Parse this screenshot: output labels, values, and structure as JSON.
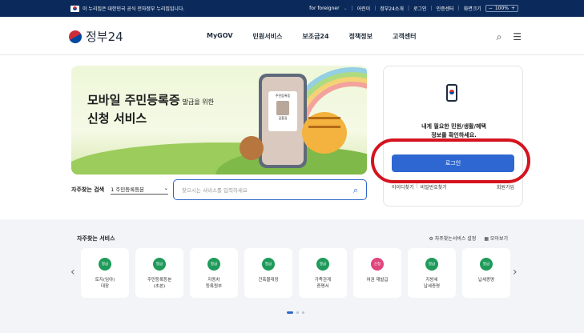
{
  "topbar": {
    "notice": "이 누리집은 대한민국 공식 전자정부 누리집입니다.",
    "links": [
      "for foreigner",
      "어린이",
      "정부24소개",
      "로그인",
      "인증센터",
      "화면크기",
      "100%"
    ]
  },
  "header": {
    "logo_text": "정부24",
    "nav": [
      "MyGOV",
      "민원서비스",
      "보조금24",
      "정책정보",
      "고객센터"
    ]
  },
  "banner": {
    "line1": "모바일 주민등록증",
    "line1_suffix": "발급을 위한",
    "line2": "신청 서비스",
    "card_title": "주민등록증",
    "card_name": "김홍길"
  },
  "search": {
    "label": "자주찾는 검색",
    "selected": "1 주민등록등본",
    "placeholder": "찾으시는 서비스를 입력하세요"
  },
  "login": {
    "desc_line1": "내게 필요한 민원/생활/혜택",
    "desc_line2": "정보를 확인하세요.",
    "button": "로그인",
    "find_id": "아이디찾기",
    "find_pw": "비밀번호찾기",
    "signup": "회원가입"
  },
  "services": {
    "title": "자주찾는 서비스",
    "settings": "자주찾는서비스 설정",
    "view_all": "모아보기",
    "items": [
      {
        "badge": "발급",
        "label": "토지(임야)\n대장",
        "color": "#1f9a5a"
      },
      {
        "badge": "발급",
        "label": "주민등록등본\n(초본)",
        "color": "#1f9a5a"
      },
      {
        "badge": "발급",
        "label": "자동차\n등록원부",
        "color": "#1f9a5a"
      },
      {
        "badge": "발급",
        "label": "건축물대장",
        "color": "#1f9a5a"
      },
      {
        "badge": "발급",
        "label": "가족관계\n증명서",
        "color": "#1f9a5a"
      },
      {
        "badge": "신청",
        "label": "여권 재발급",
        "color": "#e0457b"
      },
      {
        "badge": "발급",
        "label": "지방세\n납세증명",
        "color": "#1f9a5a"
      },
      {
        "badge": "발급",
        "label": "납세증명",
        "color": "#1f9a5a"
      }
    ]
  }
}
